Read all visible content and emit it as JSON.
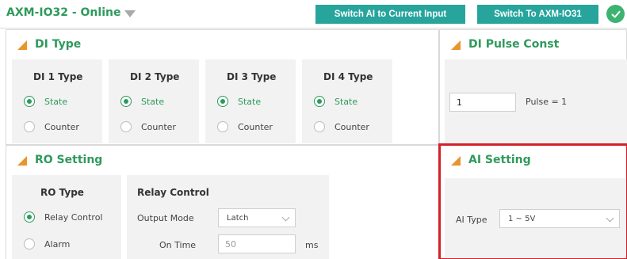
{
  "header": {
    "device_title": "AXM-IO32 - Online",
    "switch_ai_label": "Switch AI to Current Input",
    "switch_device_label": "Switch To AXM-IO31"
  },
  "di_type": {
    "title": "DI Type",
    "columns": [
      {
        "heading": "DI 1 Type",
        "state_label": "State",
        "counter_label": "Counter",
        "selected": "State"
      },
      {
        "heading": "DI 2 Type",
        "state_label": "State",
        "counter_label": "Counter",
        "selected": "State"
      },
      {
        "heading": "DI 3 Type",
        "state_label": "State",
        "counter_label": "Counter",
        "selected": "State"
      },
      {
        "heading": "DI 4 Type",
        "state_label": "State",
        "counter_label": "Counter",
        "selected": "State"
      }
    ]
  },
  "di_pulse": {
    "title": "DI Pulse Const",
    "value": "1",
    "result": "Pulse = 1"
  },
  "ro_setting": {
    "title": "RO Setting",
    "ro_type_heading": "RO Type",
    "option_relay": "Relay Control",
    "option_alarm": "Alarm",
    "selected": "Relay Control",
    "relay_heading": "Relay Control",
    "output_mode_label": "Output Mode",
    "output_mode_value": "Latch",
    "on_time_label": "On Time",
    "on_time_value": "50",
    "on_time_unit": "ms"
  },
  "ai_setting": {
    "title": "AI Setting",
    "ai_type_label": "AI Type",
    "ai_type_value": "1 ~ 5V"
  },
  "colors": {
    "accent_green": "#2e9a5c",
    "button_teal": "#27a59c",
    "title_triangle": "#e8962b",
    "highlight_red": "#d3202a"
  }
}
